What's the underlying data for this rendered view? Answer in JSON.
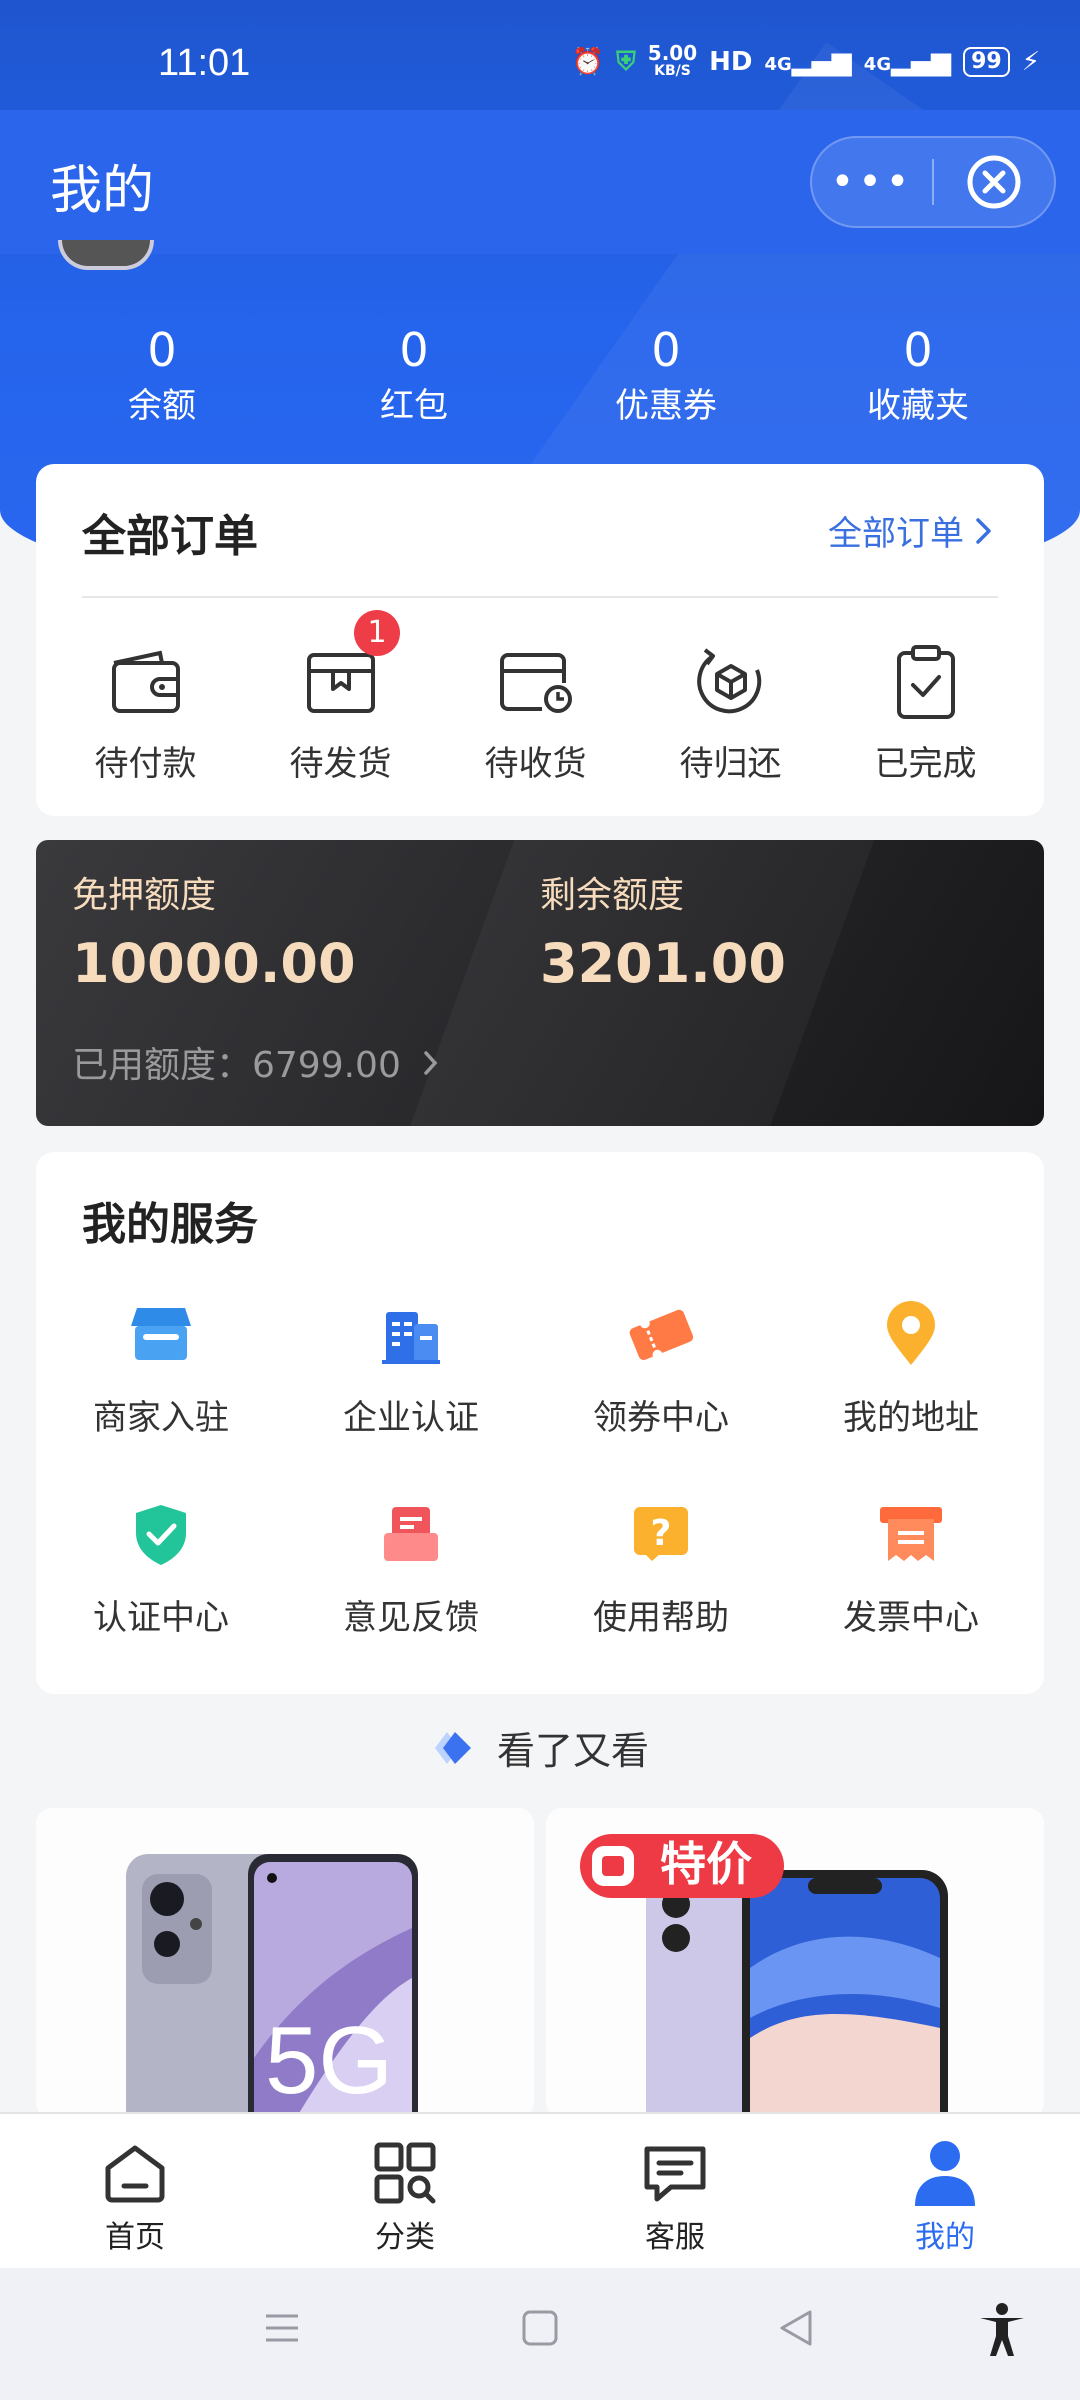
{
  "status_bar": {
    "time": "11:01",
    "speed": "5.00",
    "speed_unit": "KB/S",
    "hd": "HD",
    "net1": "4G",
    "net2": "4G",
    "battery": "99"
  },
  "header": {
    "title": "我的"
  },
  "stats": [
    {
      "value": "0",
      "label": "余额"
    },
    {
      "value": "0",
      "label": "红包"
    },
    {
      "value": "0",
      "label": "优惠券"
    },
    {
      "value": "0",
      "label": "收藏夹"
    }
  ],
  "orders": {
    "title": "全部订单",
    "all_link": "全部订单",
    "items": [
      {
        "label": "待付款",
        "icon": "wallet-icon"
      },
      {
        "label": "待发货",
        "icon": "package-icon",
        "badge": "1"
      },
      {
        "label": "待收货",
        "icon": "delivery-box-icon"
      },
      {
        "label": "待归还",
        "icon": "return-box-icon"
      },
      {
        "label": "已完成",
        "icon": "clipboard-check-icon"
      }
    ]
  },
  "credit": {
    "label_free": "免押额度",
    "value_free": "10000.00",
    "label_remaining": "剩余额度",
    "value_remaining": "3201.00",
    "used_text": "已用额度：6799.00"
  },
  "services": {
    "title": "我的服务",
    "items": [
      {
        "label": "商家入驻",
        "icon": "shop-icon"
      },
      {
        "label": "企业认证",
        "icon": "building-icon"
      },
      {
        "label": "领券中心",
        "icon": "coupon-icon"
      },
      {
        "label": "我的地址",
        "icon": "location-pin-icon"
      },
      {
        "label": "认证中心",
        "icon": "shield-check-icon"
      },
      {
        "label": "意见反馈",
        "icon": "feedback-icon"
      },
      {
        "label": "使用帮助",
        "icon": "help-icon"
      },
      {
        "label": "发票中心",
        "icon": "invoice-icon"
      }
    ]
  },
  "recommend": {
    "title": "看了又看",
    "product2_tag": "特价",
    "product1_text": "5G"
  },
  "tabs": [
    {
      "label": "首页",
      "icon": "home-icon"
    },
    {
      "label": "分类",
      "icon": "category-icon"
    },
    {
      "label": "客服",
      "icon": "chat-icon"
    },
    {
      "label": "我的",
      "icon": "profile-icon",
      "active": true
    }
  ],
  "colors": {
    "primary": "#2b6cf1",
    "badge": "#ef3d47",
    "gold": "#f6dcbd"
  }
}
